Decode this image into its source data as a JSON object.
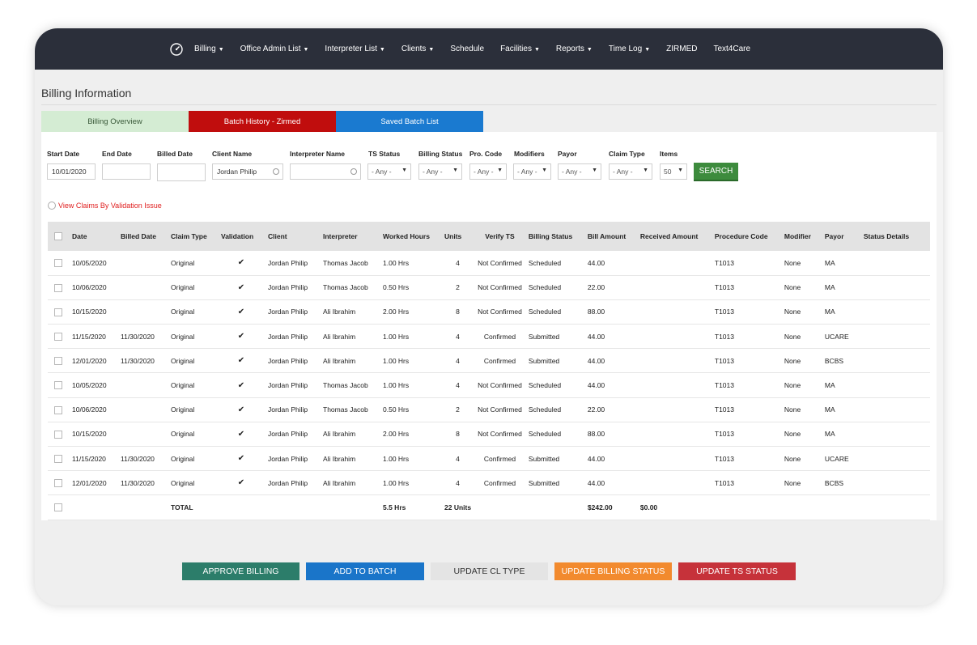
{
  "nav": {
    "items": [
      {
        "label": "Billing",
        "caret": true
      },
      {
        "label": "Office Admin List",
        "caret": true
      },
      {
        "label": "Interpreter List",
        "caret": true
      },
      {
        "label": "Clients",
        "caret": true
      },
      {
        "label": "Schedule",
        "caret": false
      },
      {
        "label": "Facilities",
        "caret": true
      },
      {
        "label": "Reports",
        "caret": true
      },
      {
        "label": "Time Log",
        "caret": true
      },
      {
        "label": "ZIRMED",
        "caret": false
      },
      {
        "label": "Text4Care",
        "caret": false
      }
    ]
  },
  "page": {
    "title": "Billing Information"
  },
  "tabs": {
    "overview": "Billing Overview",
    "batch_history": "Batch History - Zirmed",
    "saved_batch": "Saved Batch List"
  },
  "filters": {
    "start_date_label": "Start Date",
    "start_date_value": "10/01/2020",
    "end_date_label": "End Date",
    "end_date_value": "",
    "billed_date_label": "Billed Date",
    "billed_date_value": "",
    "client_name_label": "Client Name",
    "client_name_value": "Jordan Philip",
    "interpreter_name_label": "Interpreter Name",
    "interpreter_name_value": "",
    "ts_status_label": "TS Status",
    "ts_status_value": "- Any -",
    "billing_status_label": "Billing Status",
    "billing_status_value": "- Any -",
    "pro_code_label": "Pro. Code",
    "pro_code_value": "- Any -",
    "modifiers_label": "Modifiers",
    "modifiers_value": "- Any -",
    "payor_label": "Payor",
    "payor_value": "- Any -",
    "claim_type_label": "Claim Type",
    "claim_type_value": "- Any -",
    "items_label": "Items",
    "items_value": "50",
    "search_button": "SEARCH"
  },
  "validation_link": "View Claims By Validation Issue",
  "table": {
    "headers": [
      "Date",
      "Billed Date",
      "Claim Type",
      "Validation",
      "Client",
      "Interpreter",
      "Worked Hours",
      "Units",
      "Verify TS",
      "Billing Status",
      "Bill Amount",
      "Received Amount",
      "Procedure Code",
      "Modifier",
      "Payor",
      "Status Details"
    ],
    "rows": [
      {
        "date": "10/05/2020",
        "billed": "",
        "claim_type": "Original",
        "validation": "✔",
        "client": "Jordan Philip",
        "interpreter": "Thomas Jacob",
        "hours": "1.00 Hrs",
        "units": "4",
        "verify": "Not Confirmed",
        "billing_status": "Scheduled",
        "bill_amount": "44.00",
        "received": "",
        "proc": "T1013",
        "modifier": "None",
        "payor": "MA",
        "details": ""
      },
      {
        "date": "10/06/2020",
        "billed": "",
        "claim_type": "Original",
        "validation": "✔",
        "client": "Jordan Philip",
        "interpreter": "Thomas Jacob",
        "hours": "0.50 Hrs",
        "units": "2",
        "verify": "Not Confirmed",
        "billing_status": "Scheduled",
        "bill_amount": "22.00",
        "received": "",
        "proc": "T1013",
        "modifier": "None",
        "payor": "MA",
        "details": ""
      },
      {
        "date": "10/15/2020",
        "billed": "",
        "claim_type": "Original",
        "validation": "✔",
        "client": "Jordan Philip",
        "interpreter": "Ali Ibrahim",
        "hours": "2.00 Hrs",
        "units": "8",
        "verify": "Not Confirmed",
        "billing_status": "Scheduled",
        "bill_amount": "88.00",
        "received": "",
        "proc": "T1013",
        "modifier": "None",
        "payor": "MA",
        "details": ""
      },
      {
        "date": "11/15/2020",
        "billed": "11/30/2020",
        "claim_type": "Original",
        "validation": "✔",
        "client": "Jordan Philip",
        "interpreter": "Ali Ibrahim",
        "hours": "1.00 Hrs",
        "units": "4",
        "verify": "Confirmed",
        "billing_status": "Submitted",
        "bill_amount": "44.00",
        "received": "",
        "proc": "T1013",
        "modifier": "None",
        "payor": "UCARE",
        "details": ""
      },
      {
        "date": "12/01/2020",
        "billed": "11/30/2020",
        "claim_type": "Original",
        "validation": "✔",
        "client": "Jordan Philip",
        "interpreter": "Ali Ibrahim",
        "hours": "1.00 Hrs",
        "units": "4",
        "verify": "Confirmed",
        "billing_status": "Submitted",
        "bill_amount": "44.00",
        "received": "",
        "proc": "T1013",
        "modifier": "None",
        "payor": "BCBS",
        "details": ""
      },
      {
        "date": "10/05/2020",
        "billed": "",
        "claim_type": "Original",
        "validation": "✔",
        "client": "Jordan Philip",
        "interpreter": "Thomas Jacob",
        "hours": "1.00 Hrs",
        "units": "4",
        "verify": "Not Confirmed",
        "billing_status": "Scheduled",
        "bill_amount": "44.00",
        "received": "",
        "proc": "T1013",
        "modifier": "None",
        "payor": "MA",
        "details": ""
      },
      {
        "date": "10/06/2020",
        "billed": "",
        "claim_type": "Original",
        "validation": "✔",
        "client": "Jordan Philip",
        "interpreter": "Thomas Jacob",
        "hours": "0.50 Hrs",
        "units": "2",
        "verify": "Not Confirmed",
        "billing_status": "Scheduled",
        "bill_amount": "22.00",
        "received": "",
        "proc": "T1013",
        "modifier": "None",
        "payor": "MA",
        "details": ""
      },
      {
        "date": "10/15/2020",
        "billed": "",
        "claim_type": "Original",
        "validation": "✔",
        "client": "Jordan Philip",
        "interpreter": "Ali Ibrahim",
        "hours": "2.00 Hrs",
        "units": "8",
        "verify": "Not Confirmed",
        "billing_status": "Scheduled",
        "bill_amount": "88.00",
        "received": "",
        "proc": "T1013",
        "modifier": "None",
        "payor": "MA",
        "details": ""
      },
      {
        "date": "11/15/2020",
        "billed": "11/30/2020",
        "claim_type": "Original",
        "validation": "✔",
        "client": "Jordan Philip",
        "interpreter": "Ali Ibrahim",
        "hours": "1.00 Hrs",
        "units": "4",
        "verify": "Confirmed",
        "billing_status": "Submitted",
        "bill_amount": "44.00",
        "received": "",
        "proc": "T1013",
        "modifier": "None",
        "payor": "UCARE",
        "details": ""
      },
      {
        "date": "12/01/2020",
        "billed": "11/30/2020",
        "claim_type": "Original",
        "validation": "✔",
        "client": "Jordan Philip",
        "interpreter": "Ali Ibrahim",
        "hours": "1.00 Hrs",
        "units": "4",
        "verify": "Confirmed",
        "billing_status": "Submitted",
        "bill_amount": "44.00",
        "received": "",
        "proc": "T1013",
        "modifier": "None",
        "payor": "BCBS",
        "details": ""
      }
    ],
    "total": {
      "label": "TOTAL",
      "hours": "5.5 Hrs",
      "units": "22 Units",
      "bill_amount": "$242.00",
      "received": "$0.00"
    }
  },
  "actions": {
    "approve": "APPROVE BILLING",
    "add_batch": "ADD TO BATCH",
    "update_cl": "UPDATE CL TYPE",
    "update_billing": "UPDATE BILLING STATUS",
    "update_ts": "UPDATE TS STATUS"
  },
  "colors": {
    "nav_bg": "#2b2f3a",
    "tab_overview": "#d4ecd3",
    "tab_batch": "#c00d0d",
    "tab_saved": "#1a7ad0",
    "search": "#3d8b3d",
    "not_confirmed": "#e01c1c",
    "confirmed": "#2f8a2f",
    "submitted": "#2030d0"
  }
}
